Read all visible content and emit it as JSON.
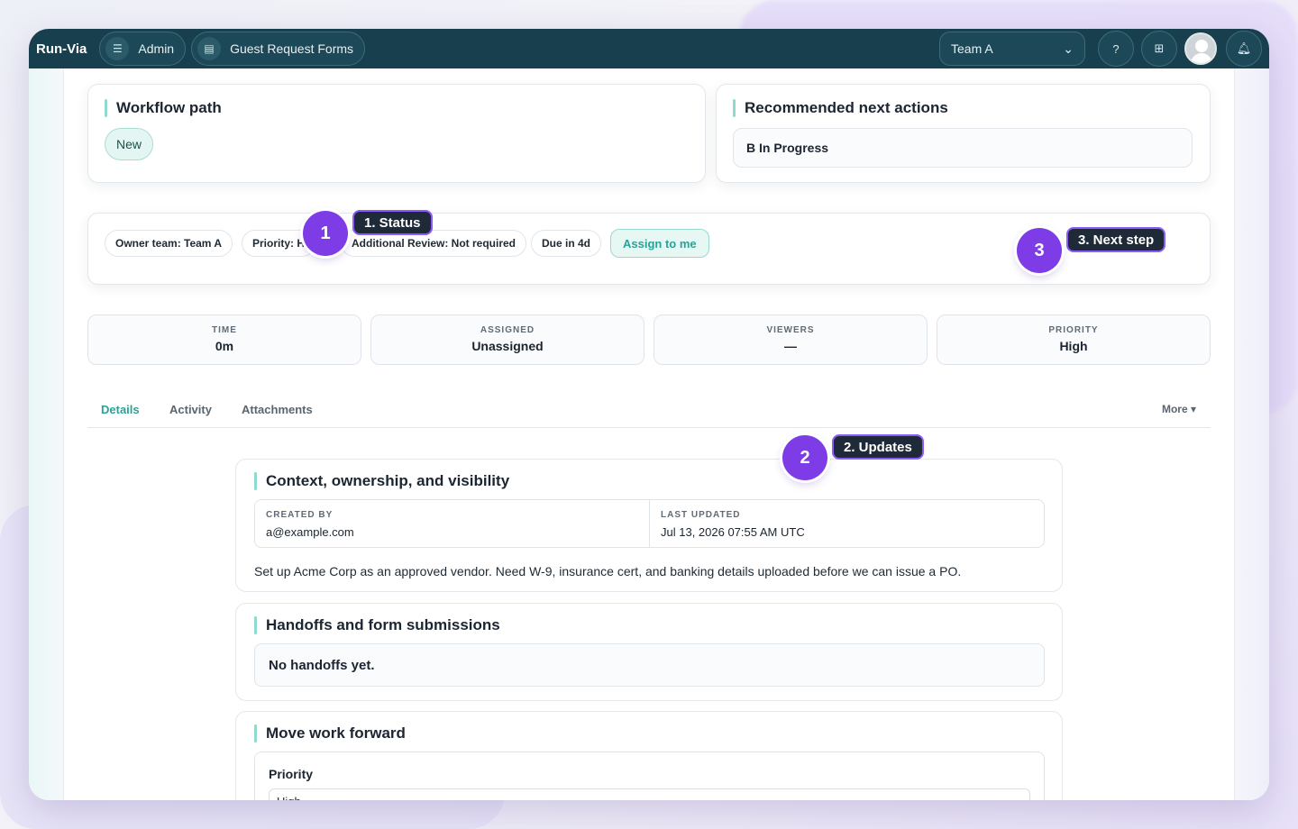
{
  "header": {
    "brand": "Run-Via",
    "nav": [
      {
        "label": "Admin",
        "icon": "sliders-icon"
      },
      {
        "label": "Guest Request Forms",
        "icon": "document-icon"
      }
    ],
    "team_select": "Team A",
    "icons": [
      "help-icon",
      "grid-icon",
      "avatar",
      "bell-icon"
    ]
  },
  "workflow": {
    "title": "Workflow path",
    "status_chip": "New"
  },
  "recommended": {
    "title": "Recommended next actions",
    "action": "B In Progress"
  },
  "tags": {
    "owner": "Owner team: Team A",
    "priority": "Priority: H",
    "review": "Additional Review: Not required",
    "due": "Due in 4d",
    "assign": "Assign to me"
  },
  "stats": [
    {
      "label": "TIME",
      "value": "0m"
    },
    {
      "label": "ASSIGNED",
      "value": "Unassigned"
    },
    {
      "label": "VIEWERS",
      "value": "—"
    },
    {
      "label": "PRIORITY",
      "value": "High"
    }
  ],
  "tabs": {
    "details": "Details",
    "activity": "Activity",
    "attachments": "Attachments",
    "more": "More ▾"
  },
  "context": {
    "title": "Context, ownership, and visibility",
    "created_by_label": "CREATED BY",
    "created_by": "a@example.com",
    "updated_label": "LAST UPDATED",
    "updated": "Jul 13, 2026 07:55 AM UTC",
    "description": "Set up Acme Corp as an approved vendor. Need W-9, insurance cert, and banking details uploaded before we can issue a PO."
  },
  "handoffs": {
    "title": "Handoffs and form submissions",
    "empty": "No handoffs yet."
  },
  "move": {
    "title": "Move work forward",
    "priority_label": "Priority",
    "priority_value": "High"
  },
  "callouts": [
    {
      "num": "1",
      "label": "1. Status"
    },
    {
      "num": "2",
      "label": "2. Updates"
    },
    {
      "num": "3",
      "label": "3. Next step"
    }
  ],
  "colors": {
    "topbar": "#183f4e",
    "accent": "#2aa394",
    "callout": "#7d3ce6"
  }
}
